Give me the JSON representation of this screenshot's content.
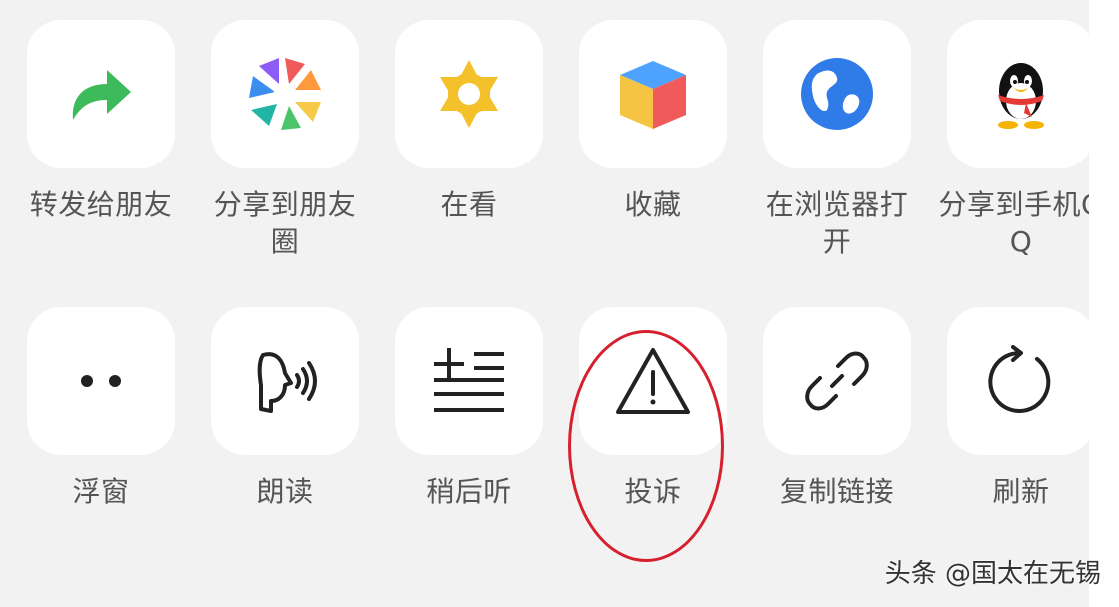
{
  "share_sheet": {
    "row1": [
      {
        "label": "转发给朋友",
        "icon": "forward-arrow-icon",
        "color": "#3dbb5a"
      },
      {
        "label": "分享到朋友圈",
        "icon": "moments-shutter-icon",
        "color": "#f05a5a"
      },
      {
        "label": "在看",
        "icon": "wow-star-icon",
        "color": "#f4c12a"
      },
      {
        "label": "收藏",
        "icon": "favorites-cube-icon",
        "color": "#4da3ff"
      },
      {
        "label": "在浏览器打开",
        "icon": "globe-icon",
        "color": "#2f7be8"
      },
      {
        "label": "分享到手机QQ",
        "icon": "qq-penguin-icon",
        "color": "#111111"
      }
    ],
    "row2": [
      {
        "label": "浮窗",
        "icon": "float-window-dots-icon"
      },
      {
        "label": "朗读",
        "icon": "read-aloud-icon"
      },
      {
        "label": "稍后听",
        "icon": "listen-later-icon"
      },
      {
        "label": "投诉",
        "icon": "warning-triangle-icon"
      },
      {
        "label": "复制链接",
        "icon": "link-icon"
      },
      {
        "label": "刷新",
        "icon": "refresh-icon"
      }
    ]
  },
  "annotation": {
    "highlight_target": "投诉",
    "highlight_color": "#d6202e"
  },
  "watermark": {
    "text": "头条 @国太在无锡"
  },
  "colors": {
    "panel_background": "#f2f2f2",
    "tile_background": "#ffffff",
    "label_text": "#555555",
    "icon_stroke": "#222222"
  }
}
